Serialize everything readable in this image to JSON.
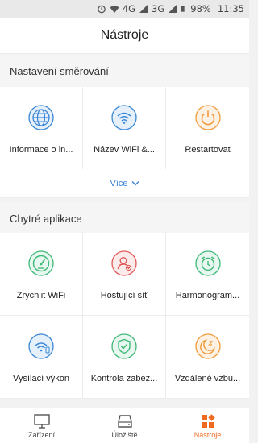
{
  "status_bar": {
    "network_1": "4G",
    "network_2": "3G",
    "battery": "98%",
    "time": "11:35"
  },
  "header": {
    "title": "Nástroje"
  },
  "routing_section": {
    "title": "Nastavení směrování",
    "items": [
      {
        "label": "Informace o in...",
        "icon": "globe-icon",
        "color": "#3a87d6"
      },
      {
        "label": "Název WiFi &...",
        "icon": "wifi-icon",
        "color": "#3a87d6"
      },
      {
        "label": "Restartovat",
        "icon": "power-icon",
        "color": "#ef9a3a"
      }
    ],
    "more_label": "Více"
  },
  "apps_section": {
    "title": "Chytré aplikace",
    "items": [
      {
        "label": "Zrychlit WiFi",
        "icon": "speedometer-icon",
        "color": "#3fb979"
      },
      {
        "label": "Hostující síť",
        "icon": "guest-user-icon",
        "color": "#e05a5a"
      },
      {
        "label": "Harmonogram...",
        "icon": "alarm-clock-icon",
        "color": "#3fb979"
      },
      {
        "label": "Vysílací výkon",
        "icon": "signal-power-icon",
        "color": "#3a87d6"
      },
      {
        "label": "Kontrola zabez...",
        "icon": "shield-check-icon",
        "color": "#3fb979"
      },
      {
        "label": "Vzdálené vzbu...",
        "icon": "sleep-moon-icon",
        "color": "#ef9a3a"
      }
    ]
  },
  "tabbar": {
    "tabs": [
      {
        "label": "Zařízení",
        "icon": "monitor-icon",
        "active": false
      },
      {
        "label": "Úložiště",
        "icon": "storage-icon",
        "active": false
      },
      {
        "label": "Nástroje",
        "icon": "tools-grid-icon",
        "active": true
      }
    ],
    "active_color": "#f06a20"
  }
}
